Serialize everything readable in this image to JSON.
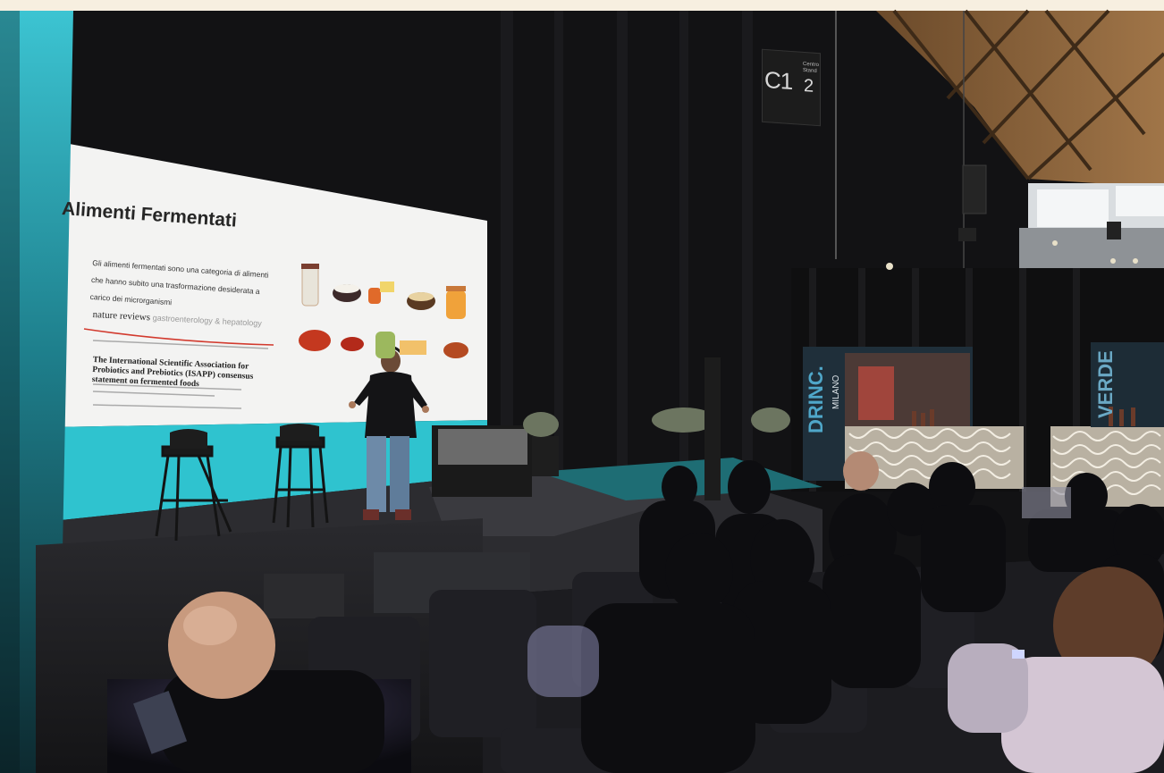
{
  "photo": {
    "description_free": true,
    "slide": {
      "title": "Alimenti Fermentati",
      "body": "Gli alimenti fermentati sono una categoria di alimenti che hanno subito una trasformazione desiderata a carico dei microrganismi",
      "journal": "nature reviews",
      "journal_sub": "gastroenterology & hepatology",
      "paper_title": "The International Scientific Association for Probiotics and Prebiotics (ISAPP) consensus statement on fermented foods"
    },
    "signs": {
      "hall": "C1",
      "hall_number": "2",
      "hall_small": "Centro Stand",
      "booth_left": "DRINC.",
      "booth_left_city": "MILANO",
      "booth_right": "VERDE"
    },
    "colors": {
      "stage_cyan": "#2fc3cf",
      "left_bar": "#2aaec0",
      "screen_white": "#f3f3f2"
    }
  }
}
